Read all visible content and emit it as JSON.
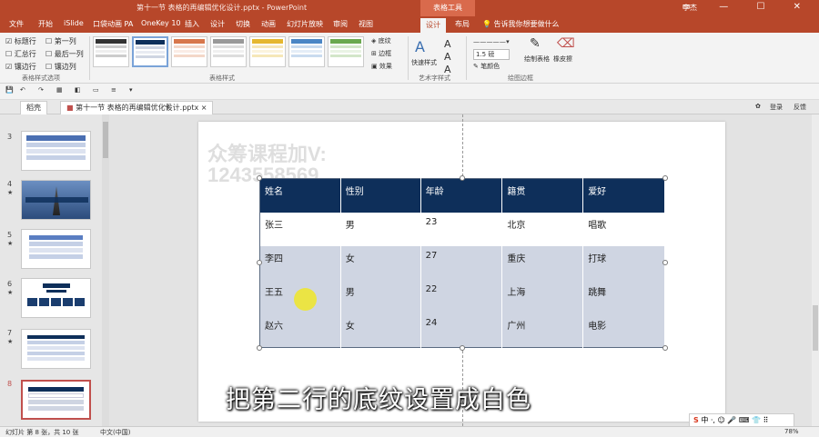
{
  "window": {
    "title": "第十一节 表格的再编辑优化设计.pptx - PowerPoint",
    "context_tab": "表格工具",
    "user": "李杰"
  },
  "tabs": [
    "文件",
    "开始",
    "iSlide",
    "口袋动画 PA",
    "OneKey 10",
    "插入",
    "设计",
    "切换",
    "动画",
    "幻灯片放映",
    "审阅",
    "视图",
    "设计",
    "布局"
  ],
  "active_tab": "设计",
  "tell_me": "告诉我你想要做什么",
  "ribbon": {
    "options": {
      "header_row": "标题行",
      "first_col": "第一列",
      "total_row": "汇总行",
      "last_col": "最后一列",
      "banded_rows": "镶边行",
      "banded_cols": "镶边列",
      "group_label": "表格样式选项"
    },
    "styles_label": "表格样式",
    "shading": "底纹",
    "border": "边框",
    "effects": "效果",
    "quick_styles": "快速样式",
    "wordart_label": "艺术字样式",
    "pen_weight": "1.5 磅",
    "pen_color": "笔颜色",
    "draw_table": "绘制表格",
    "eraser": "橡皮擦",
    "draw_border_label": "绘图边框"
  },
  "doc_tabs": [
    "稻壳",
    "第十一节 表格的再编辑优化设计.pptx"
  ],
  "doc_tab_close": "×",
  "doc_tab_add": "+",
  "doc_right": [
    "登录",
    "反馈"
  ],
  "slides": [
    {
      "num": "3",
      "star": ""
    },
    {
      "num": "4",
      "star": "★"
    },
    {
      "num": "5",
      "star": "★"
    },
    {
      "num": "6",
      "star": "★"
    },
    {
      "num": "7",
      "star": "★"
    },
    {
      "num": "8",
      "star": ""
    }
  ],
  "watermark": {
    "line1": "众筹课程加V:",
    "line2": "1243558569"
  },
  "table": {
    "headers": [
      "姓名",
      "性别",
      "年龄",
      "籍贯",
      "爱好"
    ],
    "rows": [
      [
        "张三",
        "男",
        "23",
        "北京",
        "唱歌"
      ],
      [
        "李四",
        "女",
        "27",
        "重庆",
        "打球"
      ],
      [
        "王五",
        "男",
        "22",
        "上海",
        "跳舞"
      ],
      [
        "赵六",
        "女",
        "24",
        "广州",
        "电影"
      ]
    ]
  },
  "subtitle": "把第二行的底纹设置成白色",
  "statusbar": {
    "slide_info": "幻灯片 第 8 张，共 10 张",
    "lang": "中文(中国)",
    "zoom": "78%"
  },
  "ime_text": "中 ·, ☺ 🎤 ⌨ 👕 ⠿",
  "colors": {
    "ribbon_accent": "#b7472a",
    "table_header": "#0e2f5a",
    "table_band": "#cfd5e2",
    "highlight": "#f0e628"
  }
}
